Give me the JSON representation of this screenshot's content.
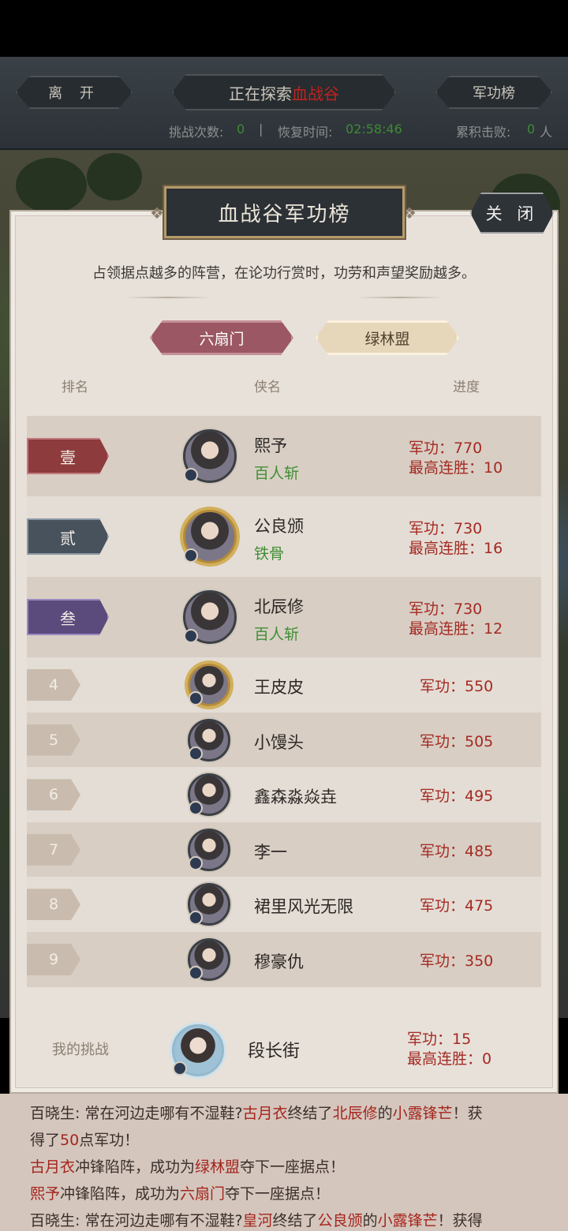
{
  "header": {
    "leave": "离 开",
    "explore_prefix": "正在探索",
    "explore_place": "血战谷",
    "merit_board": "军功榜"
  },
  "stats": {
    "challenge_label": "挑战次数:",
    "challenge_value": "0",
    "sep": "|",
    "recover_label": "恢复时间:",
    "recover_value": "02:58:46",
    "defeat_label": "累积击败:",
    "defeat_value": "0",
    "defeat_unit": "人"
  },
  "modal": {
    "title": "血战谷军功榜",
    "close": "关 闭",
    "description": "占领据点越多的阵营，在论功行赏时，功劳和声望奖励越多。",
    "tabs": [
      "六扇门",
      "绿林盟"
    ],
    "col_rank": "排名",
    "col_name": "侠名",
    "col_progress": "进度"
  },
  "ranking": [
    {
      "rank": "壹",
      "name": "熙予",
      "title": "百人斩",
      "merit": "军功：770",
      "streak": "最高连胜：10"
    },
    {
      "rank": "贰",
      "name": "公良颁",
      "title": "铁骨",
      "merit": "军功：730",
      "streak": "最高连胜：16"
    },
    {
      "rank": "叁",
      "name": "北辰修",
      "title": "百人斩",
      "merit": "军功：730",
      "streak": "最高连胜：12"
    },
    {
      "rank": "4",
      "name": "王皮皮",
      "merit": "军功：550"
    },
    {
      "rank": "5",
      "name": "小馒头",
      "merit": "军功：505"
    },
    {
      "rank": "6",
      "name": "鑫森淼焱垚",
      "merit": "军功：495"
    },
    {
      "rank": "7",
      "name": "李一",
      "merit": "军功：485"
    },
    {
      "rank": "8",
      "name": "裙里风光无限",
      "merit": "军功：475"
    },
    {
      "rank": "9",
      "name": "穆豪仇",
      "merit": "军功：350"
    }
  ],
  "my_challenge": {
    "label": "我的挑战",
    "name": "段长街",
    "merit": "军功：15",
    "streak": "最高连胜：0"
  },
  "log": {
    "l1_a": "百晓生: 常在河边走哪有不湿鞋?",
    "l1_b": "古月衣",
    "l1_c": "终结了",
    "l1_d": "北辰修",
    "l1_e": "的",
    "l1_f": "小露锋芒",
    "l1_g": "！获",
    "l2_a": "得了",
    "l2_b": "50",
    "l2_c": "点军功！",
    "l3_a": "古月衣",
    "l3_b": "冲锋陷阵，成功为",
    "l3_c": "绿林盟",
    "l3_d": "夺下一座据点！",
    "l4_a": "熙予",
    "l4_b": "冲锋陷阵，成功为",
    "l4_c": "六扇门",
    "l4_d": "夺下一座据点！",
    "l5_a": "百晓生: 常在河边走哪有不湿鞋?",
    "l5_b": "皇河",
    "l5_c": "终结了",
    "l5_d": "公良颁",
    "l5_e": "的",
    "l5_f": "小露锋芒",
    "l5_g": "！获得"
  },
  "colors": {
    "merit_red": "#a42a22",
    "title_green": "#3f8f34",
    "faction_active": "#9b5763",
    "rank1": "#8e3b3d",
    "rank2": "#48525d",
    "rank3": "#5b4a7c"
  }
}
